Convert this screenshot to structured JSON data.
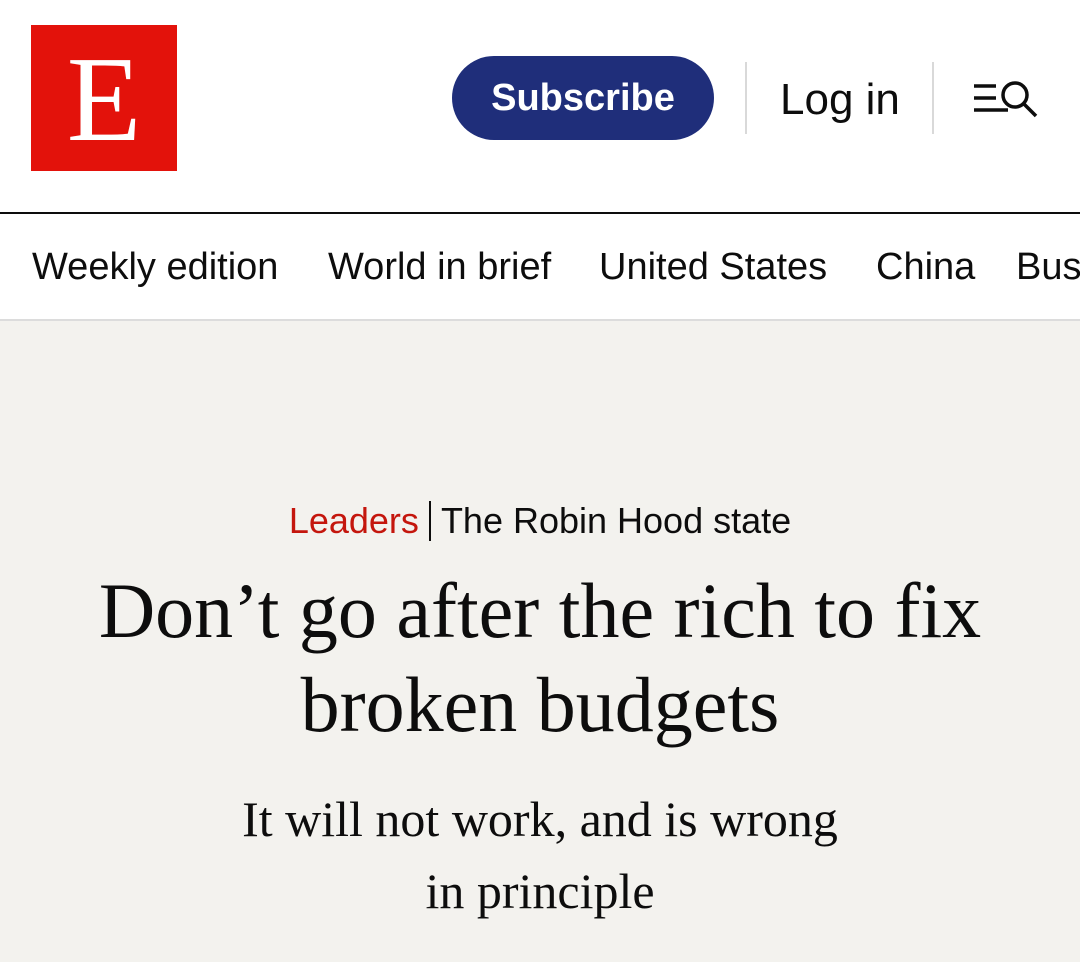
{
  "brand": {
    "logo_letter": "E",
    "color": "#e3120b"
  },
  "header": {
    "subscribe_label": "Subscribe",
    "subscribe_color": "#1f2e7a",
    "login_label": "Log in",
    "menu_icon": "menu-search-icon"
  },
  "nav": {
    "items": [
      {
        "label": "Weekly edition"
      },
      {
        "label": "World in brief"
      },
      {
        "label": "United States"
      },
      {
        "label": "China"
      },
      {
        "label": "Business"
      }
    ]
  },
  "article": {
    "section": "Leaders",
    "section_color": "#c4160d",
    "rubric": "The Robin Hood state",
    "headline": "Don’t go after the rich to fix broken budgets",
    "standfirst": "It will not work, and is wrong in principle",
    "background": "#f3f2ee"
  }
}
